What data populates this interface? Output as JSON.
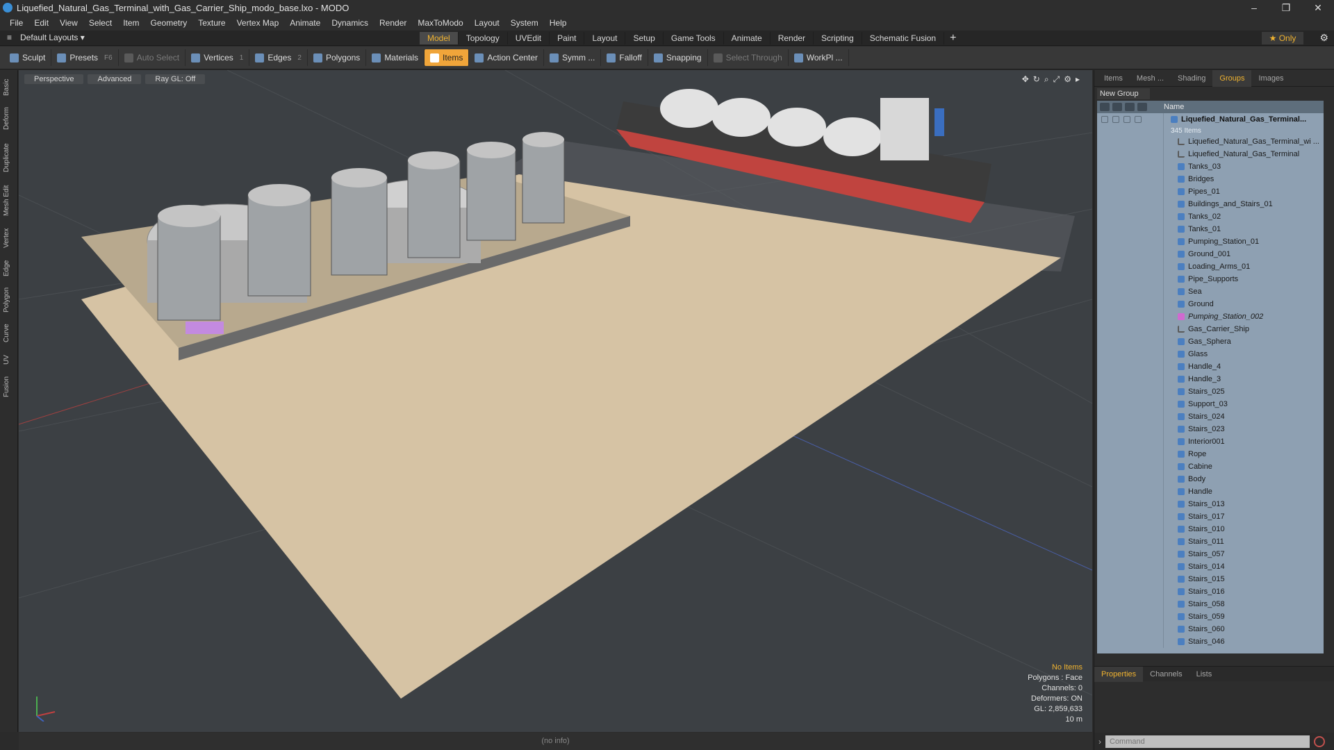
{
  "window": {
    "title": "Liquefied_Natural_Gas_Terminal_with_Gas_Carrier_Ship_modo_base.lxo - MODO",
    "minimize": "–",
    "restore": "❐",
    "close": "✕"
  },
  "menu": [
    "File",
    "Edit",
    "View",
    "Select",
    "Item",
    "Geometry",
    "Texture",
    "Vertex Map",
    "Animate",
    "Dynamics",
    "Render",
    "MaxToModo",
    "Layout",
    "System",
    "Help"
  ],
  "layout": {
    "selector": "Default Layouts ▾",
    "tabs": [
      "Model",
      "Topology",
      "UVEdit",
      "Paint",
      "Layout",
      "Setup",
      "Game Tools",
      "Animate",
      "Render",
      "Scripting",
      "Schematic Fusion"
    ],
    "active_tab": "Model",
    "add": "+",
    "only": "★  Only"
  },
  "toolbar": {
    "sculpt": "Sculpt",
    "presets": "Presets",
    "presets_key": "F6",
    "auto_select": "Auto Select",
    "vertices": "Vertices",
    "vertices_key": "1",
    "edges": "Edges",
    "edges_key": "2",
    "polygons": "Polygons",
    "materials": "Materials",
    "items": "Items",
    "action_center": "Action Center",
    "symm": "Symm ...",
    "falloff": "Falloff",
    "snapping": "Snapping",
    "select_through": "Select Through",
    "workpl": "WorkPl ..."
  },
  "left_tabs": [
    "Basic",
    "Deform",
    "Duplicate",
    "Mesh Edit",
    "Vertex",
    "Edge",
    "Polygon",
    "Curve",
    "UV",
    "Fusion"
  ],
  "viewport": {
    "view": "Perspective",
    "shading": "Advanced",
    "raygl": "Ray GL: Off",
    "info": {
      "items": "No Items",
      "polygons": "Polygons : Face",
      "channels": "Channels: 0",
      "deformers": "Deformers: ON",
      "gl": "GL: 2,859,633",
      "scale": "10 m"
    }
  },
  "status": "(no info)",
  "panel": {
    "tabs": [
      "Items",
      "Mesh ...",
      "Shading",
      "Groups",
      "Images"
    ],
    "active_tab": "Groups",
    "new_group": "New Group",
    "name_header": "Name",
    "root": "Liquefied_Natural_Gas_Terminal...",
    "root_count": "345 Items",
    "items": [
      "Liquefied_Natural_Gas_Terminal_wi ...",
      "Liquefied_Natural_Gas_Terminal",
      "Tanks_03",
      "Bridges",
      "Pipes_01",
      "Buildings_and_Stairs_01",
      "Tanks_02",
      "Tanks_01",
      "Pumping_Station_01",
      "Ground_001",
      "Loading_Arms_01",
      "Pipe_Supports",
      "Sea",
      "Ground",
      "Pumping_Station_002",
      "Gas_Carrier_Ship",
      "Gas_Sphera",
      "Glass",
      "Handle_4",
      "Handle_3",
      "Stairs_025",
      "Support_03",
      "Stairs_024",
      "Stairs_023",
      "Interior001",
      "Rope",
      "Cabine",
      "Body",
      "Handle",
      "Stairs_013",
      "Stairs_017",
      "Stairs_010",
      "Stairs_011",
      "Stairs_057",
      "Stairs_014",
      "Stairs_015",
      "Stairs_016",
      "Stairs_058",
      "Stairs_059",
      "Stairs_060",
      "Stairs_046"
    ],
    "props_tabs": [
      "Properties",
      "Channels",
      "Lists"
    ],
    "props_active": "Properties",
    "command_placeholder": "Command"
  }
}
